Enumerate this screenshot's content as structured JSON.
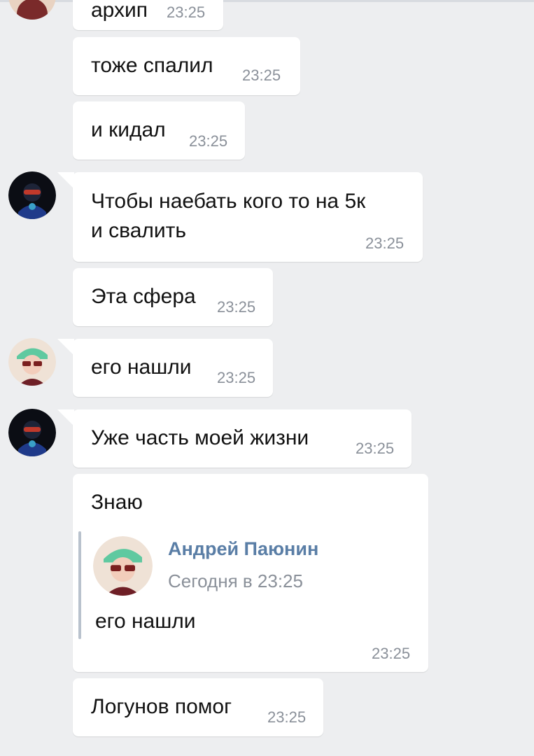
{
  "chat": {
    "messages": [
      {
        "text": "архип",
        "time": "23:25"
      },
      {
        "text": "тоже спалил",
        "time": "23:25"
      },
      {
        "text": "и кидал",
        "time": "23:25"
      },
      {
        "lines": [
          "Чтобы наебать кого то на 5к",
          "и свалить"
        ],
        "time": "23:25"
      },
      {
        "text": "Эта сфера",
        "time": "23:25"
      },
      {
        "text": "его нашли",
        "time": "23:25"
      },
      {
        "text": "Уже часть моей жизни",
        "time": "23:25"
      },
      {
        "text": "Знаю",
        "time": "23:25",
        "forwarded": {
          "author": "Андрей Паюнин",
          "date": "Сегодня в 23:25",
          "text": "его нашли"
        }
      },
      {
        "text": "Логунов помог",
        "time": "23:25"
      }
    ]
  },
  "colors": {
    "background": "#edeef0",
    "bubble": "#ffffff",
    "time": "#8a9099",
    "forward_author": "#5a7ea6"
  },
  "avatars": {
    "dark": "avatar-dark-masked-person",
    "light": "avatar-cap-sunglasses-person"
  }
}
